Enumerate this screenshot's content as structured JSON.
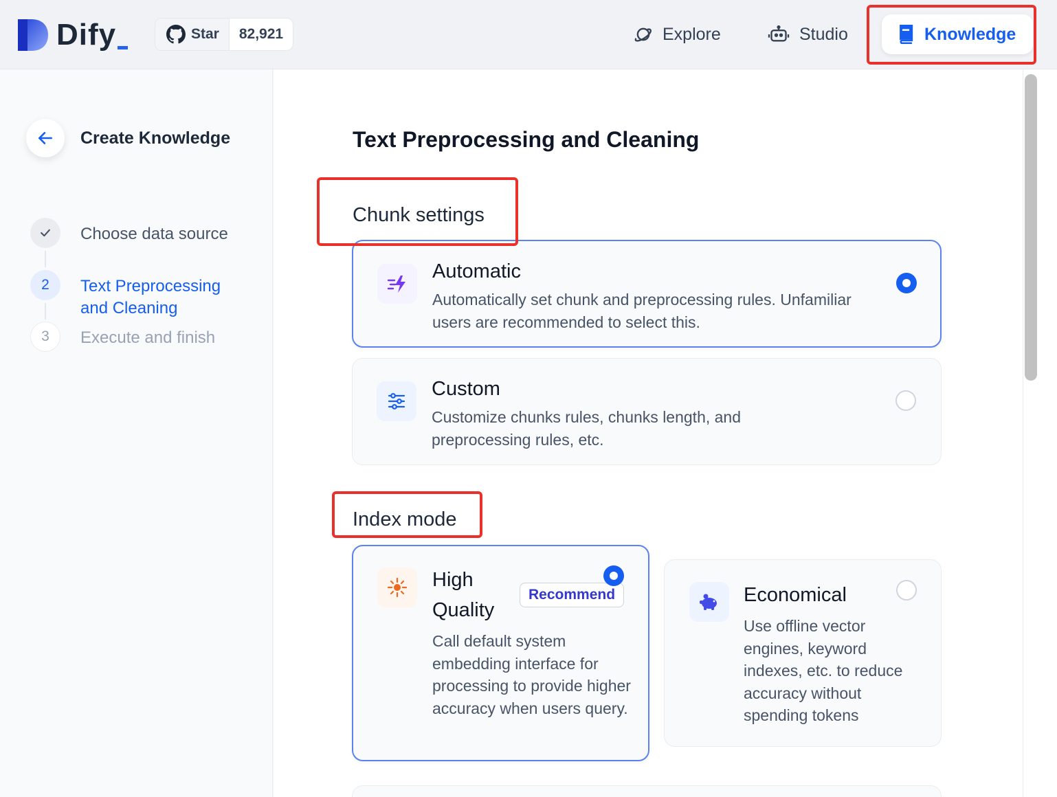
{
  "header": {
    "logo_text": "Dify",
    "github": {
      "star_label": "Star",
      "star_count": "82,921"
    },
    "nav": {
      "explore": "Explore",
      "studio": "Studio",
      "knowledge": "Knowledge"
    }
  },
  "sidebar": {
    "title": "Create Knowledge",
    "steps": [
      {
        "number": "1",
        "label": "Choose data source",
        "state": "done"
      },
      {
        "number": "2",
        "label": "Text Preprocessing and Cleaning",
        "state": "active"
      },
      {
        "number": "3",
        "label": "Execute and finish",
        "state": "pending"
      }
    ]
  },
  "main": {
    "title": "Text Preprocessing and Cleaning",
    "chunk_settings": {
      "title": "Chunk settings",
      "options": [
        {
          "title": "Automatic",
          "description": "Automatically set chunk and preprocessing rules. Unfamiliar users are recommended to select this.",
          "selected": true,
          "icon": "flash-icon"
        },
        {
          "title": "Custom",
          "description": "Customize chunks rules, chunks length, and preprocessing rules, etc.",
          "selected": false,
          "icon": "sliders-icon"
        }
      ]
    },
    "index_mode": {
      "title": "Index mode",
      "options": [
        {
          "title": "High Quality",
          "badge": "Recommend",
          "description": "Call default system embedding interface for processing to provide higher accuracy when users query.",
          "selected": true,
          "icon": "star-burst-icon"
        },
        {
          "title": "Economical",
          "description": "Use offline vector engines, keyword indexes, etc. to reduce accuracy without spending tokens",
          "selected": false,
          "icon": "piggy-bank-icon"
        }
      ]
    }
  },
  "colors": {
    "accent": "#155eef",
    "highlight": "#e8312a",
    "badge_text": "#3538cd"
  }
}
